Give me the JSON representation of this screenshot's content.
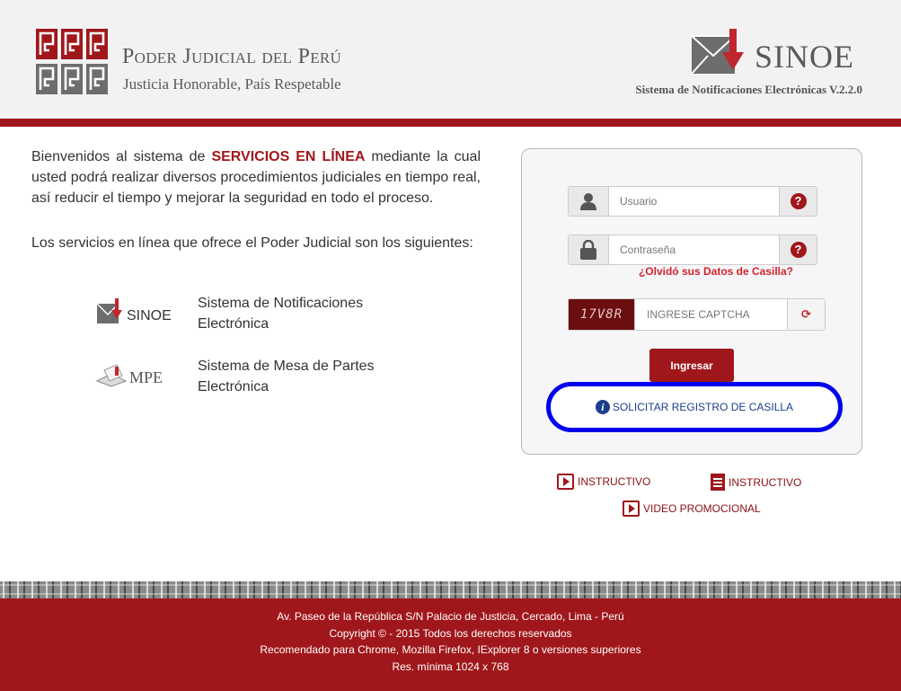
{
  "header": {
    "org_title": "Poder Judicial del Perú",
    "org_subtitle": "Justicia Honorable, País Respetable",
    "app_logo_text": "SINOE",
    "app_version": "Sistema de Notificaciones Electrónicas V.2.2.0"
  },
  "intro": {
    "part1": "Bienvenidos al sistema de ",
    "highlight": "SERVICIOS EN LÍNEA",
    "part2": " mediante la cual usted podrá realizar diversos procedimientos judiciales en tiempo real, así reducir el tiempo y mejorar la seguridad en todo el proceso.",
    "services_intro": "Los servicios en línea que ofrece el Poder Judicial son los siguientes:"
  },
  "services": [
    {
      "logo_text": "SINOE",
      "label_line1": "Sistema de Notificaciones",
      "label_line2": "Electrónica"
    },
    {
      "logo_text": "MPE",
      "label_line1": "Sistema de Mesa de Partes",
      "label_line2": "Electrónica"
    }
  ],
  "login": {
    "user_placeholder": "Usuario",
    "password_placeholder": "Contraseña",
    "help_symbol": "?",
    "forgot_link": "¿Olvidó sus Datos de Casilla?",
    "captcha_text": "17V8R",
    "captcha_placeholder": "INGRESE CAPTCHA",
    "refresh_symbol": "⟳",
    "submit_label": "Ingresar",
    "register_label": "SOLICITAR REGISTRO DE CASILLA",
    "info_symbol": "i"
  },
  "links": {
    "video_instructivo": "INSTRUCTIVO",
    "pdf_instructivo": "INSTRUCTIVO",
    "video_promocional": "VIDEO PROMOCIONAL"
  },
  "footer": {
    "line1": "Av. Paseo de la República S/N Palacio de Justicia, Cercado, Lima - Perú",
    "line2": "Copyright © - 2015 Todos los derechos reservados",
    "line3": "Recomendado para Chrome, Mozilla Firefox, IExplorer 8 o versiones superiores",
    "line4": "Res. mínima 1024 x 768"
  },
  "colors": {
    "brand_red": "#a0171b",
    "focus_blue": "#0000ee",
    "link_blue": "#1a3f8b"
  }
}
